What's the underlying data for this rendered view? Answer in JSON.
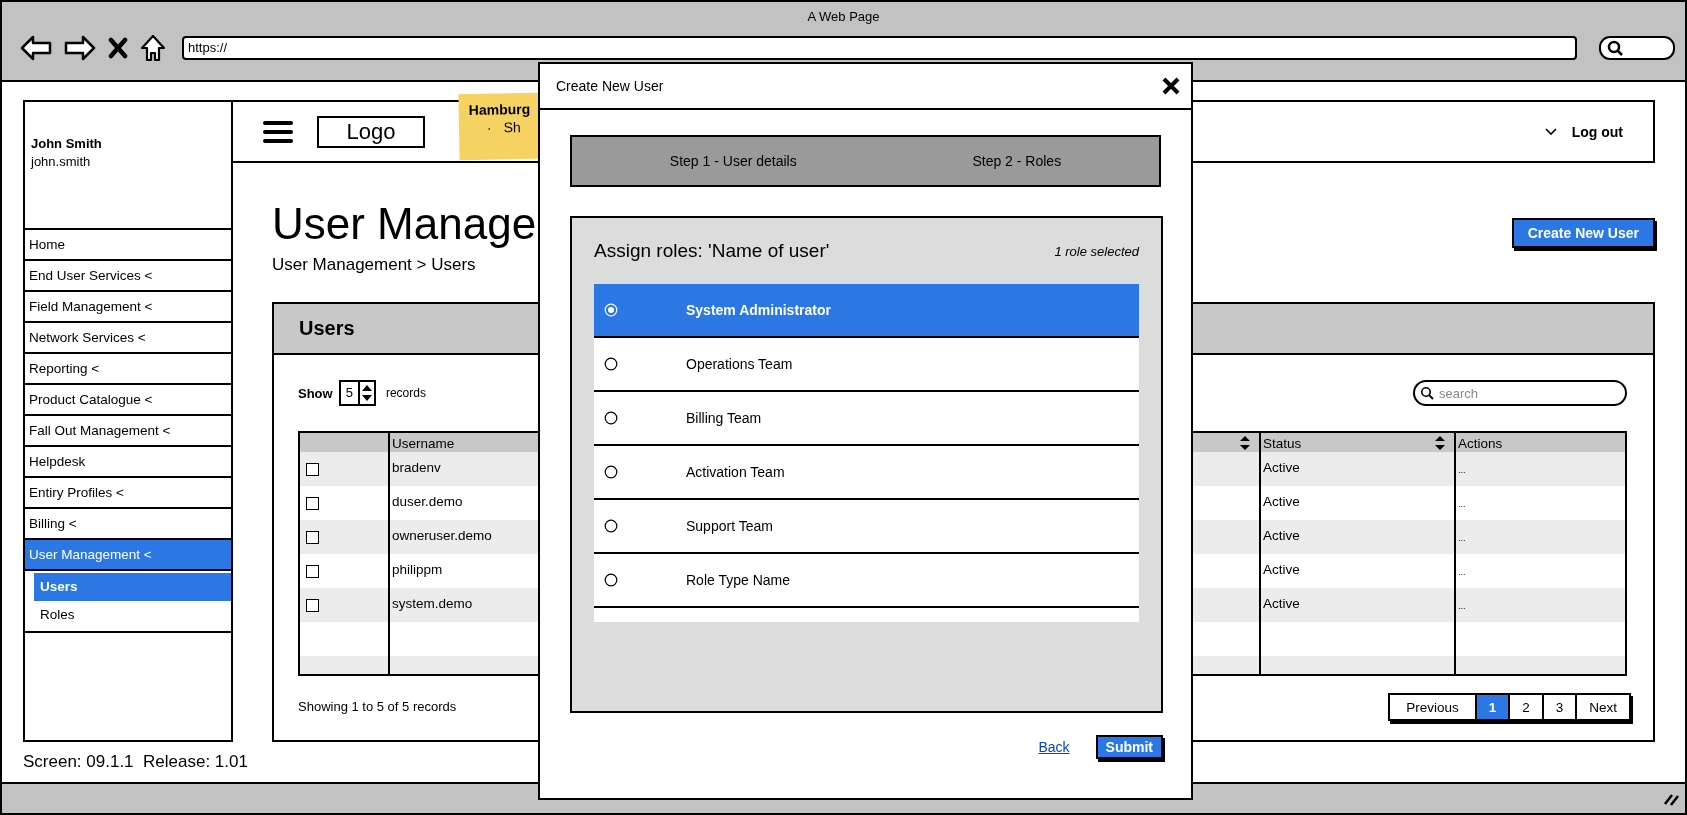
{
  "browser": {
    "title": "A Web Page",
    "url": "https://"
  },
  "sidebar": {
    "user_name": "John Smith",
    "user_login": "john.smith",
    "items": [
      {
        "label": "Home",
        "selected": false
      },
      {
        "label": "End User Services <",
        "selected": false
      },
      {
        "label": "Field Management <",
        "selected": false
      },
      {
        "label": "Network Services <",
        "selected": false
      },
      {
        "label": "Reporting <",
        "selected": false
      },
      {
        "label": "Product Catalogue <",
        "selected": false
      },
      {
        "label": "Fall Out Management <",
        "selected": false
      },
      {
        "label": "Helpdesk",
        "selected": false
      },
      {
        "label": "Entiry Profiles <",
        "selected": false
      },
      {
        "label": "Billing <",
        "selected": false
      },
      {
        "label": "User Management <",
        "selected": true,
        "children": [
          {
            "label": "Users",
            "selected": true
          },
          {
            "label": "Roles",
            "selected": false
          }
        ]
      }
    ]
  },
  "footer_note": "Screen: 09.1.1  Release: 1.01",
  "header": {
    "logo": "Logo",
    "sticky_note": {
      "title": "Hamburg",
      "bullet": "·",
      "item": "Sh"
    },
    "logout": "Log out"
  },
  "page": {
    "title": "User Manage",
    "breadcrumb": "User Management > Users",
    "create_button": "Create New User"
  },
  "users_panel": {
    "title": "Users",
    "show_label": "Show",
    "page_size": "5",
    "records_label": "records",
    "search_placeholder": "search",
    "columns": [
      {
        "label": "Username",
        "sortable": false
      },
      {
        "sortable": true
      },
      {
        "label": "Status",
        "sortable": true
      },
      {
        "label": "Actions",
        "sortable": false
      }
    ],
    "rows": [
      {
        "checked": false,
        "username": "bradenv",
        "status": "Active",
        "actions": "..."
      },
      {
        "checked": false,
        "username": "duser.demo",
        "status": "Active",
        "actions": "..."
      },
      {
        "checked": false,
        "username": "owneruser.demo",
        "status": "Active",
        "actions": "..."
      },
      {
        "checked": false,
        "username": "philippm",
        "status": "Active",
        "actions": "..."
      },
      {
        "checked": false,
        "username": "system.demo",
        "status": "Active",
        "actions": "..."
      }
    ],
    "summary": "Showing 1 to 5 of 5 records",
    "pagination": [
      {
        "label": "Previous",
        "selected": false
      },
      {
        "label": "1",
        "selected": true
      },
      {
        "label": "2",
        "selected": false
      },
      {
        "label": "3",
        "selected": false
      },
      {
        "label": "Next",
        "selected": false
      }
    ]
  },
  "modal": {
    "title": "Create New User",
    "steps": [
      "Step 1 - User details",
      "Step 2 - Roles"
    ],
    "heading": "Assign roles: 'Name of user'",
    "selection_count": "1 role selected",
    "roles": [
      {
        "label": "System Administrator",
        "selected": true
      },
      {
        "label": "Operations Team",
        "selected": false
      },
      {
        "label": "Billing Team",
        "selected": false
      },
      {
        "label": "Activation Team",
        "selected": false
      },
      {
        "label": "Support Team",
        "selected": false
      },
      {
        "label": "Role Type Name",
        "selected": false
      }
    ],
    "back": "Back",
    "submit": "Submit"
  }
}
